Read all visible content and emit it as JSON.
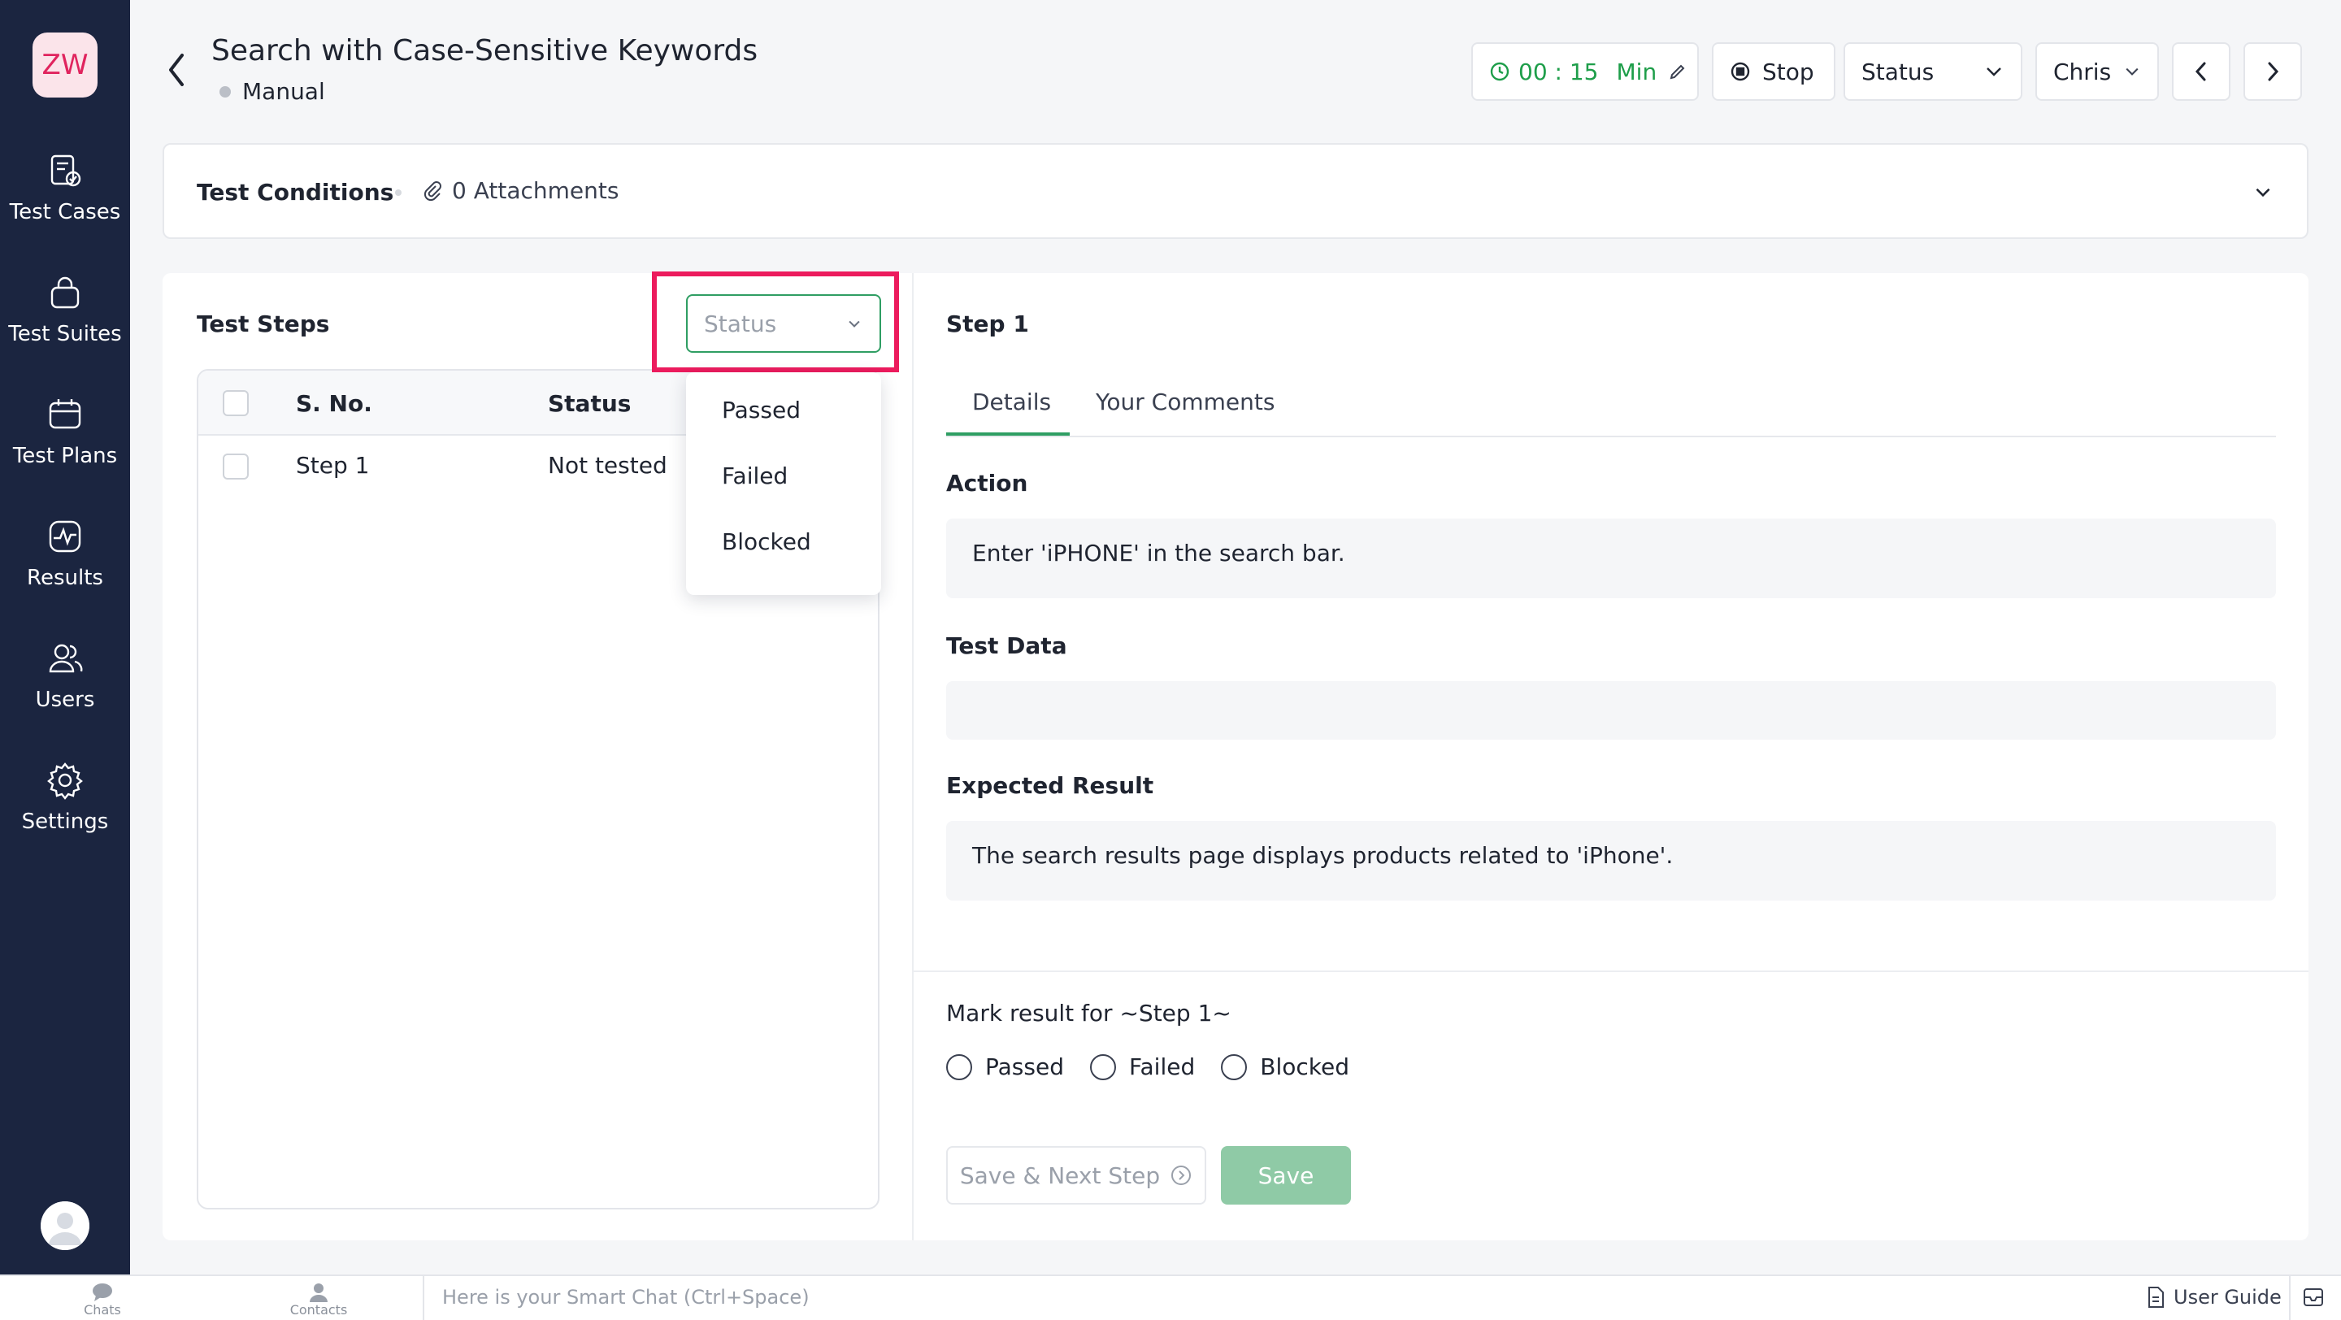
{
  "sidebar": {
    "logo_text": "ZW",
    "items": [
      {
        "label": "Test Cases",
        "icon": "test-cases-icon"
      },
      {
        "label": "Test Suites",
        "icon": "test-suites-icon"
      },
      {
        "label": "Test Plans",
        "icon": "test-plans-icon"
      },
      {
        "label": "Results",
        "icon": "results-icon"
      },
      {
        "label": "Users",
        "icon": "users-icon"
      },
      {
        "label": "Settings",
        "icon": "gear-icon"
      }
    ]
  },
  "header": {
    "title": "Search with Case-Sensitive Keywords",
    "type": "Manual",
    "timer_value": "00 : 15",
    "timer_unit": "Min",
    "stop_label": "Stop",
    "status_label": "Status",
    "user_label": "Chris"
  },
  "conditions": {
    "title": "Test Conditions",
    "attachments": "0 Attachments"
  },
  "steps": {
    "title": "Test Steps",
    "filter_placeholder": "Status",
    "columns": [
      "S. No.",
      "Status"
    ],
    "rows": [
      {
        "sno": "Step 1",
        "status": "Not tested"
      }
    ],
    "filter_options": [
      "Passed",
      "Failed",
      "Blocked"
    ]
  },
  "detail": {
    "title": "Step 1",
    "tabs": [
      "Details",
      "Your Comments"
    ],
    "action_label": "Action",
    "action_value": "Enter 'iPHONE' in the search bar.",
    "test_data_label": "Test Data",
    "test_data_value": "",
    "expected_label": "Expected Result",
    "expected_value": "The search results page displays products related to 'iPhone'.",
    "mark_label": "Mark result for ~Step 1~",
    "results": [
      "Passed",
      "Failed",
      "Blocked"
    ],
    "save_next_label": "Save & Next Step",
    "save_label": "Save"
  },
  "bottom_bar": {
    "chats": "Chats",
    "contacts": "Contacts",
    "smart_chat_placeholder": "Here is your Smart Chat (Ctrl+Space)",
    "user_guide": "User Guide"
  },
  "colors": {
    "sidebar_bg": "#1b2540",
    "accent_green": "#2f9e63",
    "highlight": "#ec1b5d",
    "logo_text": "#e0245e"
  }
}
